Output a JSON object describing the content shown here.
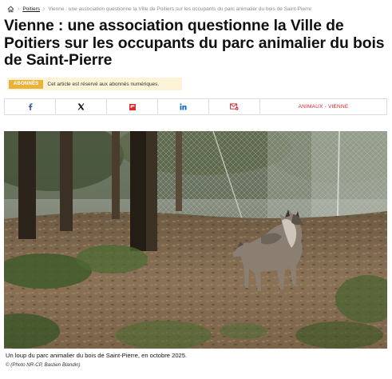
{
  "breadcrumb": {
    "home_icon": "home-icon",
    "separator": "›",
    "section": "Poitiers",
    "current": "Vienne : une association questionne la Ville de Poitiers sur les occupants du parc animalier du bois de Saint-Pierre"
  },
  "article": {
    "title": "Vienne : une association questionne la Ville de Poitiers sur les occupants du parc animalier du bois de Saint-Pierre"
  },
  "premium": {
    "badge": "ABONNÉS",
    "note": "Cet article est réservé aux abonnés numériques."
  },
  "share": {
    "buttons": [
      {
        "icon": "facebook-icon",
        "color": "#3b5998"
      },
      {
        "icon": "x-icon",
        "color": "#111111"
      },
      {
        "icon": "flipboard-icon",
        "color": "#e12828"
      },
      {
        "icon": "linkedin-icon",
        "color": "#0a66c2"
      },
      {
        "icon": "email-icon",
        "color": "#d0242b"
      }
    ],
    "tag": "ANIMAUX - VIENNE"
  },
  "photo": {
    "caption": "Un loup du parc animalier du bois de Saint-Pierre, en octobre 2025.",
    "credit": "© (Photo NR-CP, Bastien Blandin)"
  },
  "colors": {
    "accent": "#d0242b",
    "badge": "#e9b23b",
    "badge_bg": "#fdf3d6"
  }
}
